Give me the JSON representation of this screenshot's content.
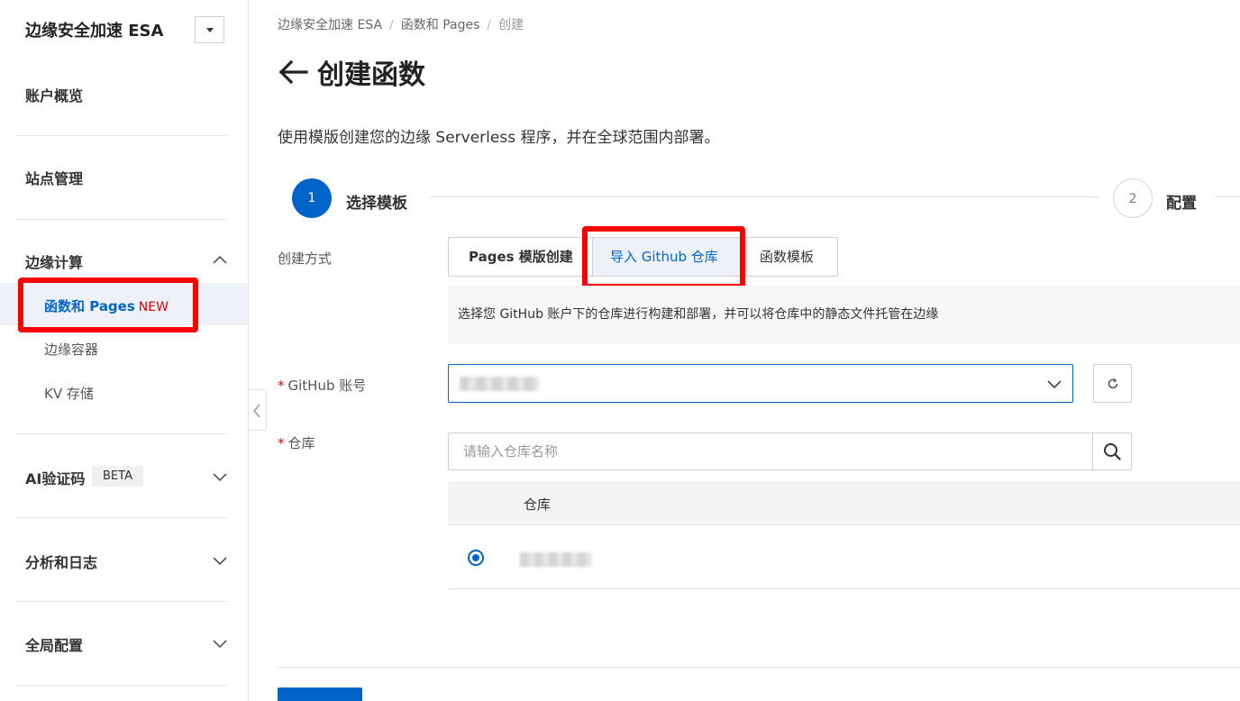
{
  "sidebar": {
    "title": "边缘安全加速 ESA",
    "groups": {
      "overview": "账户概览",
      "site_management": "站点管理",
      "edge_compute": "边缘计算",
      "ai_captcha": "AI验证码",
      "ai_captcha_badge": "BETA",
      "analytics": "分析和日志",
      "global_config": "全局配置"
    },
    "edge_compute_items": {
      "functions_pages": "函数和 Pages",
      "functions_pages_badge": "NEW",
      "edge_container": "边缘容器",
      "kv_storage": "KV 存储"
    }
  },
  "breadcrumb": [
    "边缘安全加速 ESA",
    "函数和 Pages",
    "创建"
  ],
  "page": {
    "title": "创建函数",
    "description": "使用模版创建您的边缘 Serverless 程序，并在全球范围内部署。"
  },
  "steps": [
    {
      "number": "1",
      "label": "选择模板",
      "status": "active"
    },
    {
      "number": "2",
      "label": "配置",
      "status": "pending"
    }
  ],
  "form": {
    "create_method_label": "创建方式",
    "create_methods": [
      "Pages 模版创建",
      "导入 Github 仓库",
      "函数模板"
    ],
    "selected_method": "导入 Github 仓库",
    "info_text": "选择您 GitHub 账户下的仓库进行构建和部署，并可以将仓库中的静态文件托管在边缘",
    "required_mark": "*",
    "github_account_label": "GitHub 账号",
    "repo_label": "仓库",
    "repo_search_placeholder": "请输入仓库名称",
    "repo_table_header": "仓库"
  },
  "colors": {
    "primary": "#0064c8",
    "highlight": "#ff0000",
    "badge_new": "#ee0000"
  }
}
